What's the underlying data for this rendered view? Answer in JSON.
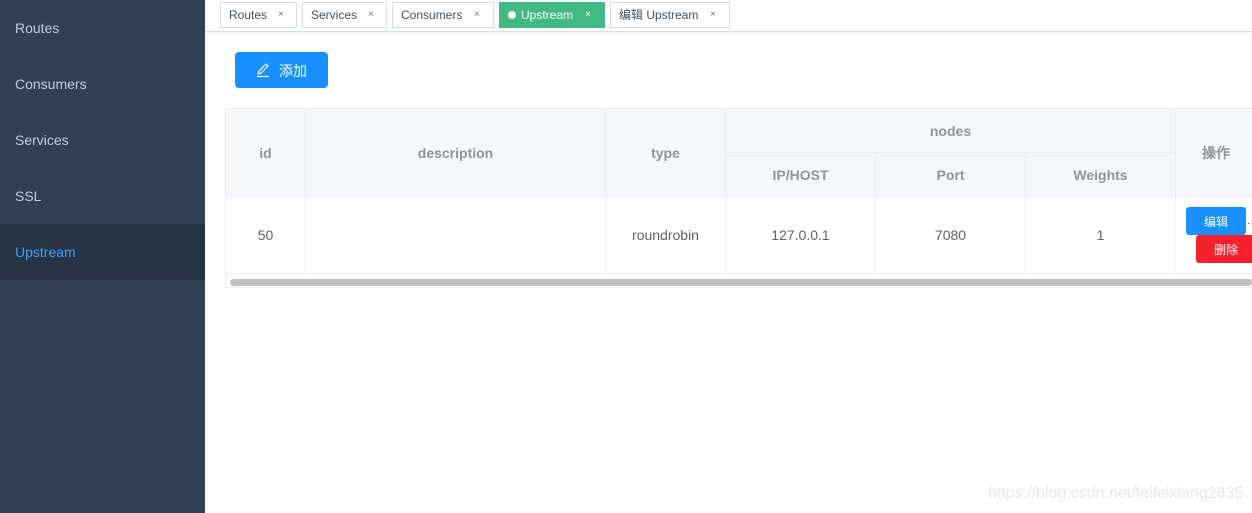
{
  "sidebar": {
    "items": [
      {
        "label": "Routes"
      },
      {
        "label": "Consumers"
      },
      {
        "label": "Services"
      },
      {
        "label": "SSL"
      },
      {
        "label": "Upstream"
      }
    ]
  },
  "tags": [
    {
      "label": "Routes",
      "close": "×"
    },
    {
      "label": "Services",
      "close": "×"
    },
    {
      "label": "Consumers",
      "close": "×"
    },
    {
      "label": "Upstream",
      "close": "×",
      "active": true
    },
    {
      "label": "编辑 Upstream",
      "close": "×"
    }
  ],
  "toolbar": {
    "add_label": "添加",
    "add_icon": "edit-pen-icon"
  },
  "table": {
    "headers": {
      "id": "id",
      "description": "description",
      "type": "type",
      "nodes": "nodes",
      "ip_host": "IP/HOST",
      "port": "Port",
      "weights": "Weights",
      "actions": "操作"
    },
    "rows": [
      {
        "id": "50",
        "description": "",
        "type": "roundrobin",
        "ip_host": "127.0.0.1",
        "port": "7080",
        "weights": "1",
        "edit_label": "编辑",
        "delete_label": "删除",
        "more": "..."
      }
    ]
  },
  "watermark": "https://blog.csdn.net/feifeixiang2835",
  "colors": {
    "sidebar_bg": "#304156",
    "sidebar_active_text": "#409eff",
    "tag_active": "#42b983",
    "primary": "#1890ff",
    "danger": "#f5222d"
  }
}
